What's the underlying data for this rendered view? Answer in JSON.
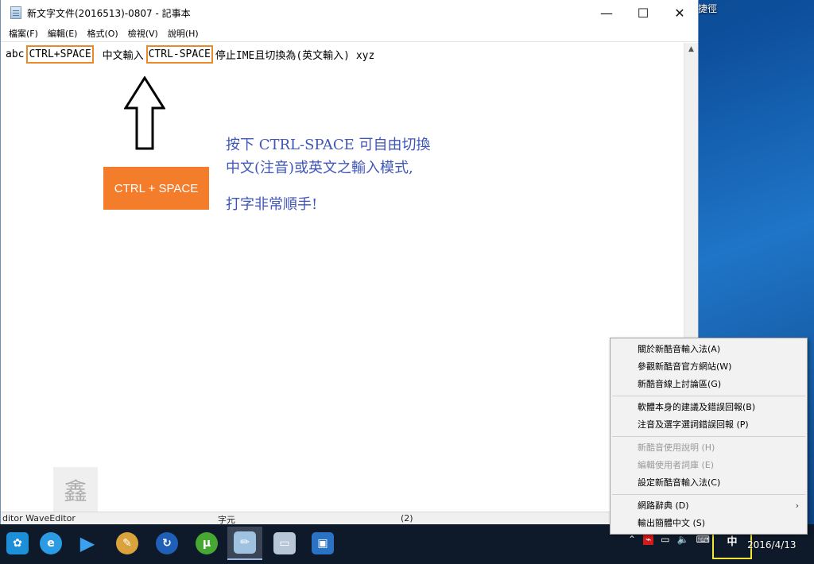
{
  "desktop": {
    "shortcut_label": "捷徑"
  },
  "window": {
    "title": "新文字文件(2016513)-0807 - 記事本",
    "controls": {
      "minimize": "—",
      "maximize": "☐",
      "close": "✕"
    }
  },
  "menu": {
    "items": [
      "檔案(F)",
      "編輯(E)",
      "格式(O)",
      "檢視(V)",
      "說明(H)"
    ]
  },
  "editor": {
    "segments": {
      "prefix": "abc",
      "ctrl_plus": "CTRL+SPACE",
      "chinese_input": " 中文輸入",
      "ctrl_minus": "CTRL-SPACE",
      "suffix": "停止IME且切換為(英文輸入) xyz"
    }
  },
  "annotations": {
    "ctrl_box": "CTRL + SPACE",
    "note_line1": "按下 CTRL-SPACE 可自由切換",
    "note_line2": "中文(注音)或英文之輸入模式,",
    "note_line3": "打字非常順手!",
    "watermark": "鑫"
  },
  "statusbar": {
    "left": "ditor WaveEditor",
    "mid": "字元",
    "right": "(2)"
  },
  "context_menu": {
    "items": [
      {
        "label": "關於新酷音輸入法(A)",
        "disabled": false
      },
      {
        "label": "參觀新酷音官方網站(W)",
        "disabled": false
      },
      {
        "label": "新酷音線上討論區(G)",
        "disabled": false
      },
      {
        "label": "軟體本身的建議及錯誤回報(B)",
        "disabled": false
      },
      {
        "label": "注音及選字選詞錯誤回報 (P)",
        "disabled": false
      },
      {
        "label": "新酷音使用說明 (H)",
        "disabled": true
      },
      {
        "label": "編輯使用者詞庫 (E)",
        "disabled": true
      },
      {
        "label": "設定新酷音輸入法(C)",
        "disabled": false
      },
      {
        "label": "網路辭典 (D)",
        "disabled": false
      },
      {
        "label": "輸出簡體中文 (S)",
        "disabled": false
      }
    ],
    "submenu_arrow": "›"
  },
  "taskbar": {
    "ime_indicator": "中",
    "clock_date": "2016/4/13",
    "tray_icons": [
      "chevron-up-icon",
      "acrobat-icon",
      "battery-icon",
      "volume-icon",
      "keyboard-icon"
    ]
  },
  "colors": {
    "accent_orange": "#f47d2c",
    "note_blue": "#3f55b8",
    "highlight_yellow": "#f4e536"
  }
}
